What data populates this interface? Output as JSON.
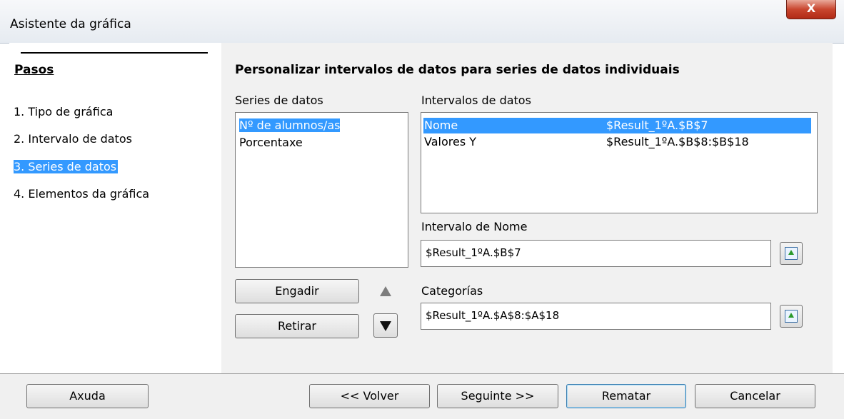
{
  "window": {
    "title": "Asistente da gráfica",
    "close_label": "X"
  },
  "steps": {
    "heading": "Pasos",
    "items": [
      {
        "label": "1. Tipo de gráfica",
        "selected": false
      },
      {
        "label": "2. Intervalo de datos",
        "selected": false
      },
      {
        "label": "3. Series de datos",
        "selected": true
      },
      {
        "label": "4. Elementos da gráfica",
        "selected": false
      }
    ]
  },
  "main": {
    "heading": "Personalizar intervalos de datos para series de datos individuais",
    "series_label": "Series de datos",
    "series_items": [
      {
        "label": "Nº de alumnos/as",
        "selected": true
      },
      {
        "label": "Porcentaxe",
        "selected": false
      }
    ],
    "ranges_label": "Intervalos de datos",
    "ranges": [
      {
        "name": "Nome",
        "value": "$Result_1ºA.$B$7",
        "selected": true
      },
      {
        "name": "Valores Y",
        "value": "$Result_1ºA.$B$8:$B$18",
        "selected": false
      }
    ],
    "name_range_label": "Intervalo de Nome",
    "name_range_value": "$Result_1ºA.$B$7",
    "categories_label": "Categorías",
    "categories_value": "$Result_1ºA.$A$8:$A$18",
    "add_label": "Engadir",
    "remove_label": "Retirar"
  },
  "footer": {
    "help": "Axuda",
    "back": "<< Volver",
    "next": "Seguinte >>",
    "finish": "Rematar",
    "cancel": "Cancelar"
  }
}
